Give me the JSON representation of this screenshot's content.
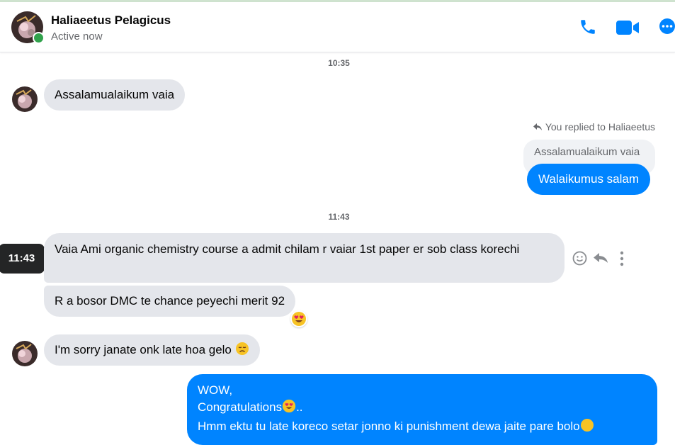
{
  "header": {
    "name": "Haliaeetus Pelagicus",
    "status": "Active now",
    "icons": [
      "phone-icon",
      "video-camera-icon",
      "more-options-icon"
    ]
  },
  "colors": {
    "accent": "#0084ff",
    "incoming_bubble": "#e4e6eb",
    "online": "#31a24c",
    "tooltip": "#242526"
  },
  "timestamps": [
    "10:35",
    "11:43"
  ],
  "messages": {
    "m1": "Assalamualaikum vaia",
    "reply_note": "You replied to Haliaeetus",
    "reply_quote": "Assalamualaikum vaia",
    "reply": "Walaikumus salam",
    "m2": "Vaia Ami organic chemistry course a admit chilam r vaiar 1st paper er sob class korechi",
    "m3": "R a bosor DMC te chance peyechi merit 92",
    "m3_reaction": "heart-eyes-emoji",
    "m4": "I'm sorry janate onk late hoa gelo",
    "m4_emoji": "disappointed-emoji",
    "m5_line1": "WOW,",
    "m5_line2": "Congratulations",
    "m5_line2_suffix": "..",
    "m5_line3": "Hmm ektu tu late koreco setar jonno ki punishment dewa jaite pare bolo"
  },
  "hover": {
    "time_tooltip": "11:43",
    "actions": [
      "react-icon",
      "reply-icon",
      "more-vertical-icon"
    ]
  }
}
